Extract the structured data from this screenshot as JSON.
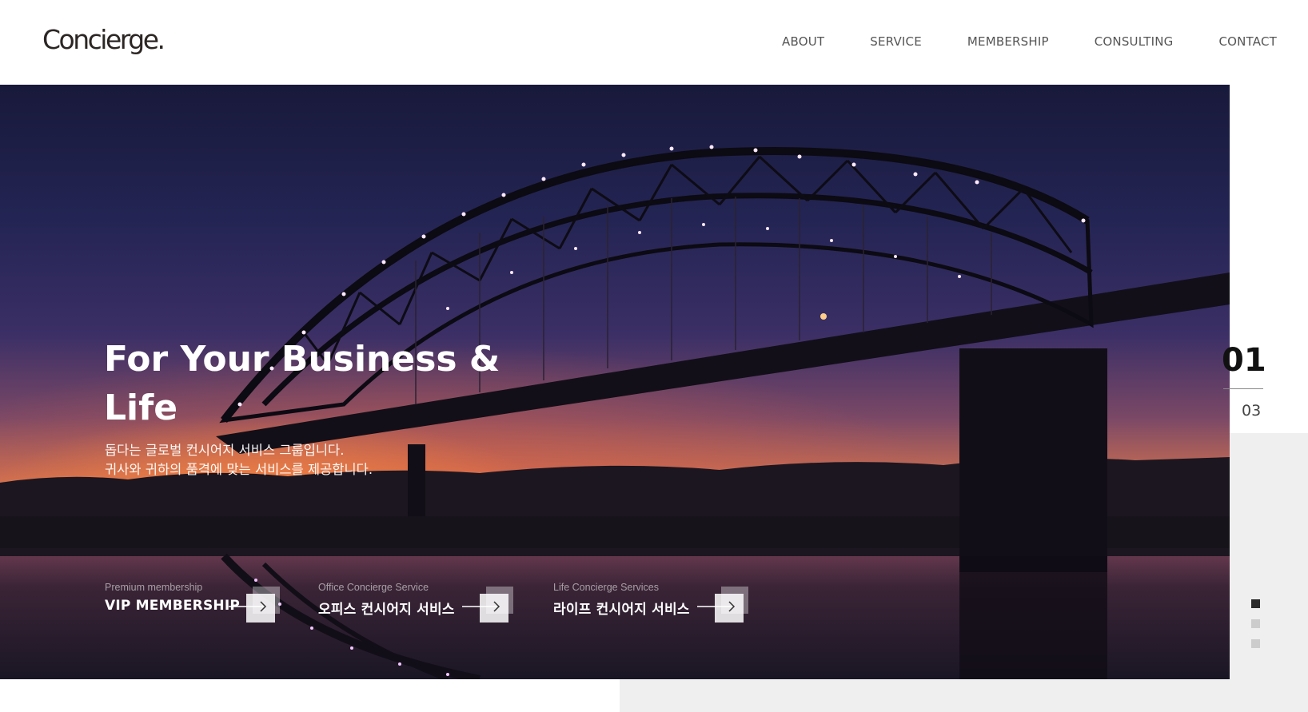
{
  "header": {
    "logo": "Concierge.",
    "nav": [
      "ABOUT",
      "SERVICE",
      "MEMBERSHIP",
      "CONSULTING",
      "CONTACT"
    ]
  },
  "hero": {
    "title": "For Your Business & Life",
    "subtitle_line1": "돕다는 글로벌 컨시어지 서비스 그룹입니다.",
    "subtitle_line2": "귀사와 귀하의 품격에 맞는 서비스를 제공합니다.",
    "services": [
      {
        "small": "Premium membership",
        "big": "VIP MEMBERSHIP"
      },
      {
        "small": "Office Concierge Service",
        "big": "오피스 컨시어지 서비스"
      },
      {
        "small": "Life Concierge Services",
        "big": "라이프 컨시어지 서비스"
      }
    ]
  },
  "slider": {
    "current": "01",
    "total": "03",
    "active_index": 0,
    "dot_count": 3
  },
  "colors": {
    "accent_dark": "#2b2b2b",
    "panel_grey": "#efefef"
  }
}
